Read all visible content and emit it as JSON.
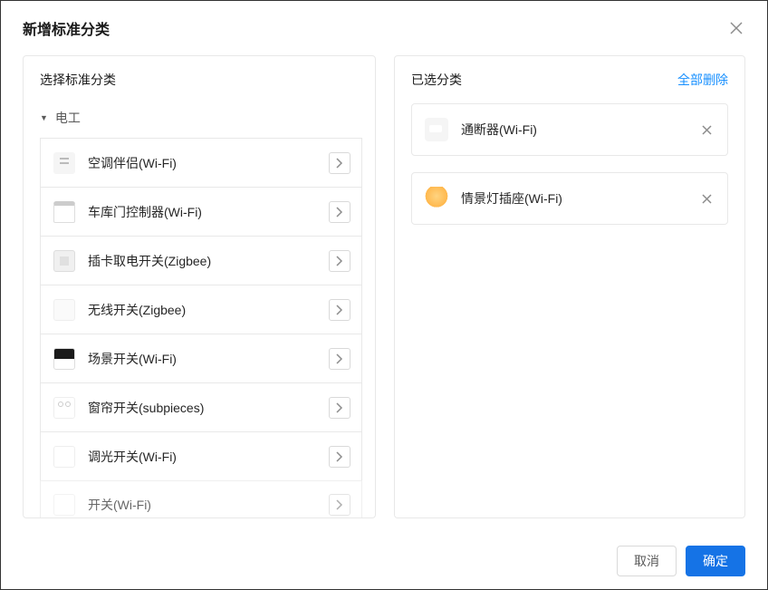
{
  "modal": {
    "title": "新增标准分类"
  },
  "left_panel": {
    "title": "选择标准分类",
    "group_label": "电工",
    "items": [
      {
        "label": "空调伴侣(Wi-Fi)",
        "icon": "ico-socket"
      },
      {
        "label": "车库门控制器(Wi-Fi)",
        "icon": "ico-garage"
      },
      {
        "label": "插卡取电开关(Zigbee)",
        "icon": "ico-card"
      },
      {
        "label": "无线开关(Zigbee)",
        "icon": "ico-wireless"
      },
      {
        "label": "场景开关(Wi-Fi)",
        "icon": "ico-scene"
      },
      {
        "label": "窗帘开关(subpieces)",
        "icon": "ico-curtain"
      },
      {
        "label": "调光开关(Wi-Fi)",
        "icon": "ico-dimmer"
      },
      {
        "label": "开关(Wi-Fi)",
        "icon": "ico-switch"
      }
    ]
  },
  "right_panel": {
    "title": "已选分类",
    "action_label": "全部删除",
    "items": [
      {
        "label": "通断器(Wi-Fi)",
        "icon": "ico-breaker"
      },
      {
        "label": "情景灯插座(Wi-Fi)",
        "icon": "ico-lamp"
      }
    ]
  },
  "footer": {
    "cancel_label": "取消",
    "confirm_label": "确定"
  }
}
